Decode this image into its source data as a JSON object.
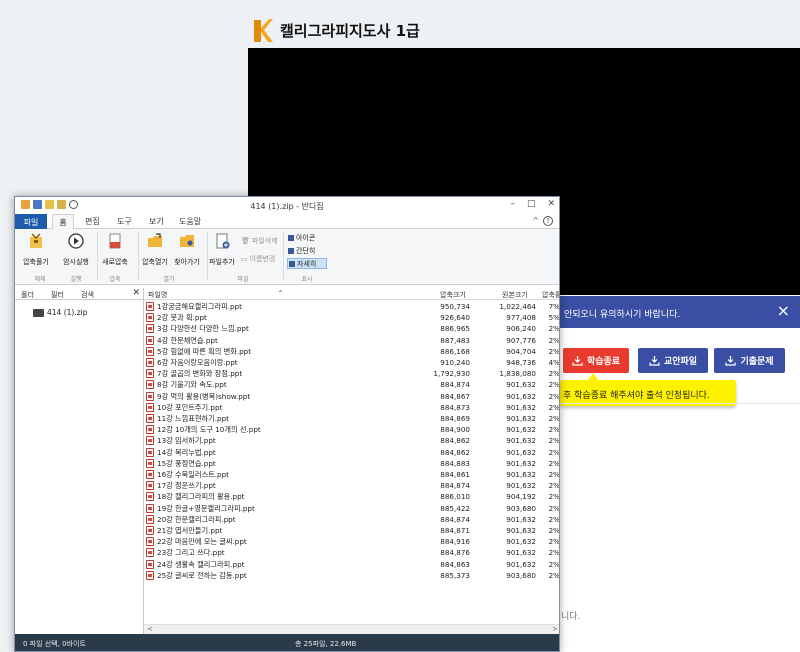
{
  "web": {
    "title": "캘리그라피지도사 1급",
    "notice": "안되오니 유의하시기 바랍니다.",
    "close_icon": "×",
    "buttons": {
      "finish": "학습종료",
      "materials": "교안파일",
      "exam": "기출문제"
    },
    "tooltip": "후 학습종료 해주셔야 출석 인정됩니다.",
    "footer_fragment": "니다.",
    "colors": {
      "brand_blue": "#3a4fa3",
      "finish_red": "#e93a2e",
      "tooltip_yellow": "#fff200",
      "logo_orange": "#f6a623"
    }
  },
  "window": {
    "title": "414 (1).zip - 반디집",
    "controls": {
      "minimize": "–",
      "maximize": "□",
      "close": "✕"
    },
    "ribbon_tabs": [
      "파일",
      "홈",
      "편집",
      "도구",
      "보기",
      "도움말"
    ],
    "ribbon_right": {
      "collapse": "^",
      "help": "?"
    },
    "ribbon": {
      "extract": "압축풀기",
      "test": "암시실행",
      "new_archive": "새로압축",
      "open_archive": "압축열기",
      "find": "찾아가기",
      "add_file": "파일추가",
      "delete_file": "파일삭제",
      "rename": "이름변경",
      "view_icon": "아이콘",
      "view_brief": "간단히",
      "view_detail": "자세히"
    },
    "ribbon_groups": [
      "해제",
      "실행",
      "압축",
      "열기",
      "파일",
      "표시"
    ],
    "left_tabs": [
      "폴더",
      "필터",
      "검색"
    ],
    "left_close": "✕",
    "tree_item": "414 (1).zip",
    "columns": {
      "name": "파일명",
      "compressed": "압축크기",
      "original": "원본크기",
      "ratio": "압축률"
    },
    "files": [
      {
        "name": "1강궁금해요캘리그라피.ppt",
        "compressed": "950,734",
        "original": "1,022,464",
        "ratio": "7%"
      },
      {
        "name": "2강 붓과 획.ppt",
        "compressed": "926,640",
        "original": "977,408",
        "ratio": "5%"
      },
      {
        "name": "3강 다양한선 다양한 느낌.ppt",
        "compressed": "886,965",
        "original": "906,240",
        "ratio": "2%"
      },
      {
        "name": "4강 한문체연습.ppt",
        "compressed": "887,483",
        "original": "907,776",
        "ratio": "2%"
      },
      {
        "name": "5강 힘없에 따른 획의 변화.ppt",
        "compressed": "886,168",
        "original": "904,704",
        "ratio": "2%"
      },
      {
        "name": "6강 자음이랑모음이랑.ppt",
        "compressed": "910,240",
        "original": "948,736",
        "ratio": "4%"
      },
      {
        "name": "7강 골곱의 변화와 장점.ppt",
        "compressed": "1,792,930",
        "original": "1,838,080",
        "ratio": "2%"
      },
      {
        "name": "8강 기울기와 속도.ppt",
        "compressed": "884,874",
        "original": "901,632",
        "ratio": "2%"
      },
      {
        "name": "9강 먹의 활용(병목)show.ppt",
        "compressed": "884,867",
        "original": "901,632",
        "ratio": "2%"
      },
      {
        "name": "10강 포인트주기.ppt",
        "compressed": "884,873",
        "original": "901,632",
        "ratio": "2%"
      },
      {
        "name": "11강 느낌표현하기.ppt",
        "compressed": "884,869",
        "original": "901,632",
        "ratio": "2%"
      },
      {
        "name": "12강 10개의 도구 10개의 선.ppt",
        "compressed": "884,900",
        "original": "901,632",
        "ratio": "2%"
      },
      {
        "name": "13강 임서하기.ppt",
        "compressed": "884,862",
        "original": "901,632",
        "ratio": "2%"
      },
      {
        "name": "14강 목리누법.ppt",
        "compressed": "884,862",
        "original": "901,632",
        "ratio": "2%"
      },
      {
        "name": "15강 풍정연습.ppt",
        "compressed": "884,883",
        "original": "901,632",
        "ratio": "2%"
      },
      {
        "name": "16강 수묵일러스트.ppt",
        "compressed": "884,861",
        "original": "901,632",
        "ratio": "2%"
      },
      {
        "name": "17강 정운쓰기.ppt",
        "compressed": "884,874",
        "original": "901,632",
        "ratio": "2%"
      },
      {
        "name": "18강 캘리그라피의 활용.ppt",
        "compressed": "886,010",
        "original": "904,192",
        "ratio": "2%"
      },
      {
        "name": "19강 한글+영문캘리그라피.ppt",
        "compressed": "885,422",
        "original": "903,680",
        "ratio": "2%"
      },
      {
        "name": "20강 한문캘리그라피.ppt",
        "compressed": "884,874",
        "original": "901,632",
        "ratio": "2%"
      },
      {
        "name": "21강 엽서만들기.ppt",
        "compressed": "884,871",
        "original": "901,632",
        "ratio": "2%"
      },
      {
        "name": "22강 마음만에 모는 글씨.ppt",
        "compressed": "884,916",
        "original": "901,632",
        "ratio": "2%"
      },
      {
        "name": "23강 그리고 쓰다.ppt",
        "compressed": "884,876",
        "original": "901,632",
        "ratio": "2%"
      },
      {
        "name": "24강 생활속 캘리그라피.ppt",
        "compressed": "884,863",
        "original": "901,632",
        "ratio": "2%"
      },
      {
        "name": "25강 글씨로 전하는 감동.ppt",
        "compressed": "885,373",
        "original": "903,680",
        "ratio": "2%"
      }
    ],
    "status_left": "0 파일 선택, 0바이트",
    "status_right": "총 25파일, 22.6MB"
  }
}
